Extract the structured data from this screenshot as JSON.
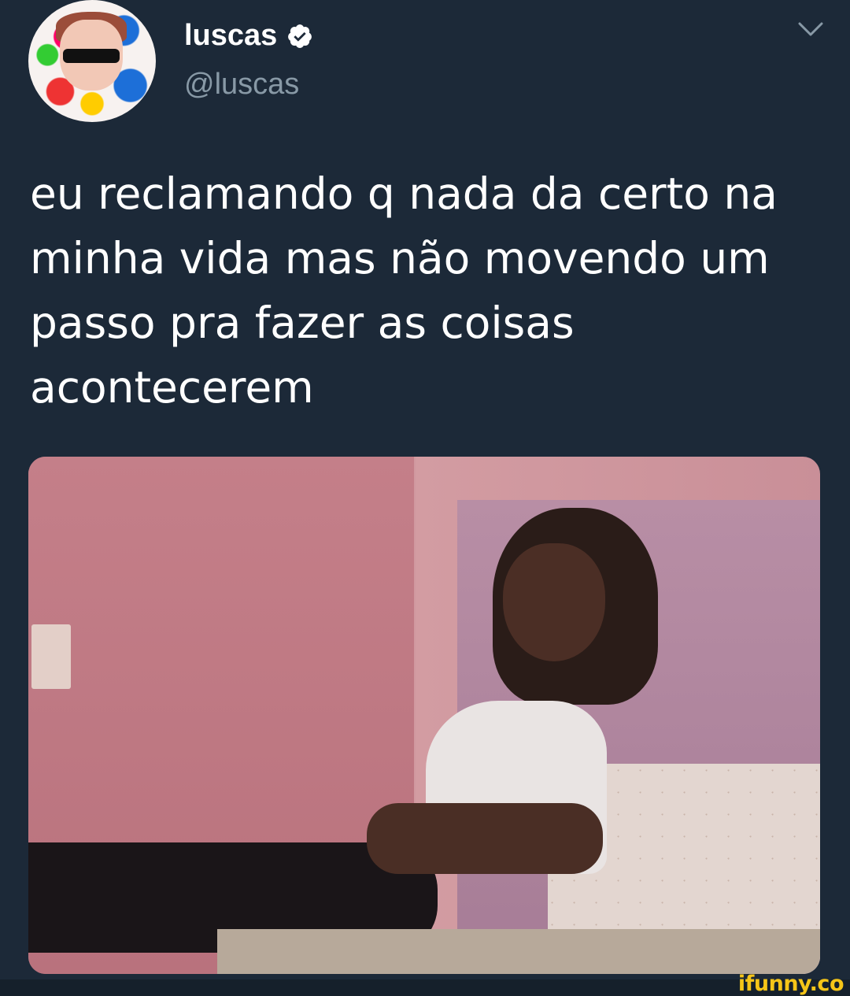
{
  "tweet": {
    "display_name": "luscas",
    "verified": true,
    "handle": "@luscas",
    "text": "eu reclamando q nada da certo na\nminha vida mas não movendo um\npasso pra fazer as coisas\nacontecerem",
    "media_alt": "photo"
  },
  "icons": {
    "verified": "verified-badge-icon",
    "menu": "chevron-down-icon"
  },
  "colors": {
    "background": "#1c2938",
    "text": "#ffffff",
    "secondary_text": "#8899a6",
    "watermark": "#f5c518"
  },
  "watermark": {
    "text": "ifunny.co"
  }
}
